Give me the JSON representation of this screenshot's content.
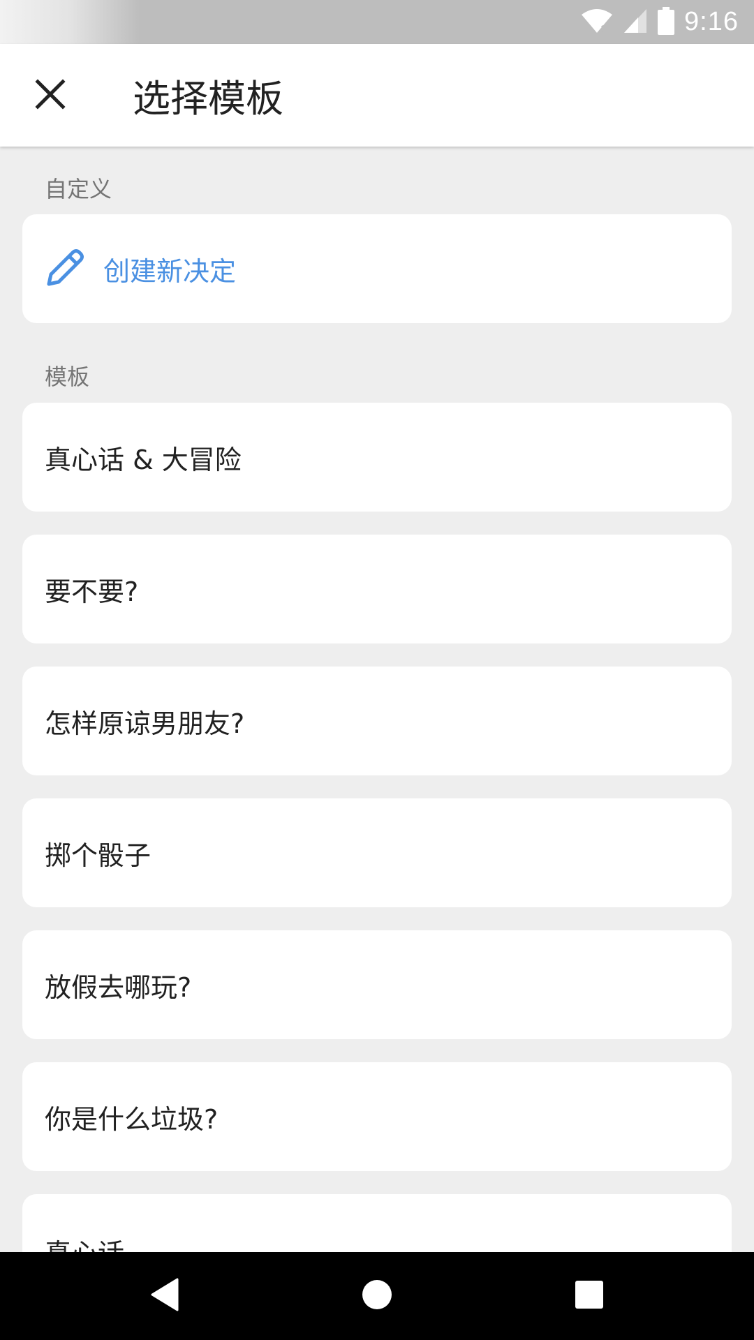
{
  "status_bar": {
    "time": "9:16",
    "icons": [
      "wifi-icon",
      "signal-icon",
      "battery-icon"
    ]
  },
  "app_bar": {
    "close_icon": "close-icon",
    "title": "选择模板"
  },
  "sections": {
    "custom": {
      "header": "自定义",
      "create_label": "创建新决定",
      "create_icon": "pencil-icon"
    },
    "templates": {
      "header": "模板",
      "items": [
        {
          "label": "真心话 & 大冒险"
        },
        {
          "label": "要不要?"
        },
        {
          "label": "怎样原谅男朋友?"
        },
        {
          "label": "掷个骰子"
        },
        {
          "label": "放假去哪玩?"
        },
        {
          "label": "你是什么垃圾?"
        },
        {
          "label": "真心话"
        }
      ]
    }
  },
  "nav_bar": {
    "icons": [
      "back-icon",
      "home-icon",
      "recents-icon"
    ]
  },
  "colors": {
    "accent": "#4a90e2",
    "background": "#eeeeee",
    "card": "#ffffff",
    "status_bar": "#bdbdbd",
    "nav_bar": "#000000"
  }
}
